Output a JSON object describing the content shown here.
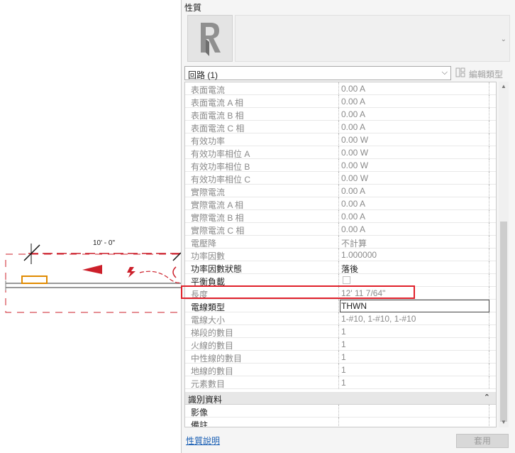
{
  "canvas": {
    "dimension_text": "10' - 0\""
  },
  "panel": {
    "title": "性質",
    "type_selector": {
      "value": "回路 (1)"
    },
    "edit_type_label": "編輯類型",
    "properties": [
      {
        "name": "表面電流",
        "value": "0.00 A",
        "state": "readonly"
      },
      {
        "name": "表面電流 A 相",
        "value": "0.00 A",
        "state": "readonly"
      },
      {
        "name": "表面電流 B 相",
        "value": "0.00 A",
        "state": "readonly"
      },
      {
        "name": "表面電流 C 相",
        "value": "0.00 A",
        "state": "readonly"
      },
      {
        "name": "有效功率",
        "value": "0.00 W",
        "state": "readonly"
      },
      {
        "name": "有效功率相位 A",
        "value": "0.00 W",
        "state": "readonly"
      },
      {
        "name": "有效功率相位 B",
        "value": "0.00 W",
        "state": "readonly"
      },
      {
        "name": "有效功率相位 C",
        "value": "0.00 W",
        "state": "readonly"
      },
      {
        "name": "實際電流",
        "value": "0.00 A",
        "state": "readonly"
      },
      {
        "name": "實際電流 A 相",
        "value": "0.00 A",
        "state": "readonly"
      },
      {
        "name": "實際電流 B 相",
        "value": "0.00 A",
        "state": "readonly"
      },
      {
        "name": "實際電流 C 相",
        "value": "0.00 A",
        "state": "readonly"
      },
      {
        "name": "電壓降",
        "value": "不計算",
        "state": "readonly"
      },
      {
        "name": "功率因數",
        "value": "1.000000",
        "state": "readonly"
      },
      {
        "name": "功率因數狀態",
        "value": "落後",
        "state": "editable"
      },
      {
        "name": "平衡負載",
        "value": "",
        "state": "checkbox"
      },
      {
        "name": "長度",
        "value": "12'  11 7/64\"",
        "state": "readonly"
      },
      {
        "name": "電線類型",
        "value": "THWN",
        "state": "input"
      },
      {
        "name": "電線大小",
        "value": "1-#10, 1-#10, 1-#10",
        "state": "readonly"
      },
      {
        "name": "梯段的數目",
        "value": "1",
        "state": "readonly"
      },
      {
        "name": "火線的數目",
        "value": "1",
        "state": "readonly"
      },
      {
        "name": "中性線的數目",
        "value": "1",
        "state": "readonly"
      },
      {
        "name": "地線的數目",
        "value": "1",
        "state": "readonly"
      },
      {
        "name": "元素數目",
        "value": "1",
        "state": "readonly"
      }
    ],
    "group_identity": {
      "label": "識別資料",
      "collapse_icon": "double-chevron-up-icon"
    },
    "identity_rows": [
      {
        "name": "影像",
        "value": ""
      },
      {
        "name": "備註",
        "value": ""
      }
    ],
    "help_link": "性質說明",
    "apply_button": "套用"
  },
  "colors": {
    "highlight": "#e0212b",
    "dashed": "#cc1f2a",
    "fixture": "#e08a00",
    "link": "#1a5fb4"
  }
}
